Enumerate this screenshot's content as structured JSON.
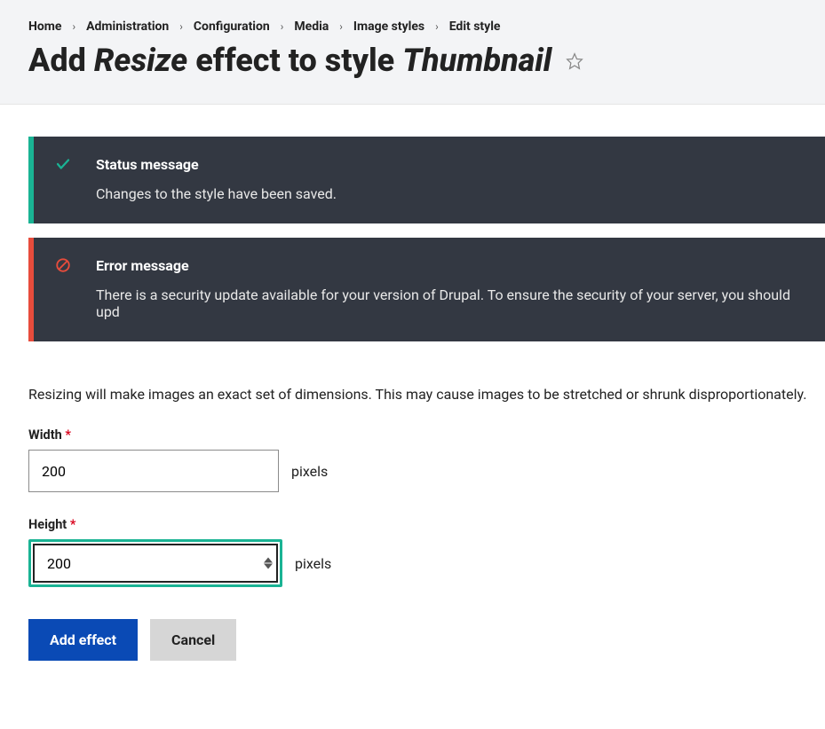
{
  "breadcrumb": {
    "items": [
      {
        "label": "Home"
      },
      {
        "label": "Administration"
      },
      {
        "label": "Configuration"
      },
      {
        "label": "Media"
      },
      {
        "label": "Image styles"
      },
      {
        "label": "Edit style"
      }
    ]
  },
  "title": {
    "part1": "Add ",
    "em1": "Resize",
    "part2": " effect to style ",
    "em2": "Thumbnail"
  },
  "messages": {
    "status": {
      "heading": "Status message",
      "body": "Changes to the style have been saved."
    },
    "error": {
      "heading": "Error message",
      "body": "There is a security update available for your version of Drupal. To ensure the security of your server, you should upd"
    }
  },
  "form": {
    "description": "Resizing will make images an exact set of dimensions. This may cause images to be stretched or shrunk disproportionately.",
    "width": {
      "label": "Width",
      "value": "200",
      "suffix": "pixels"
    },
    "height": {
      "label": "Height",
      "value": "200",
      "suffix": "pixels"
    }
  },
  "actions": {
    "submit": "Add effect",
    "cancel": "Cancel"
  }
}
